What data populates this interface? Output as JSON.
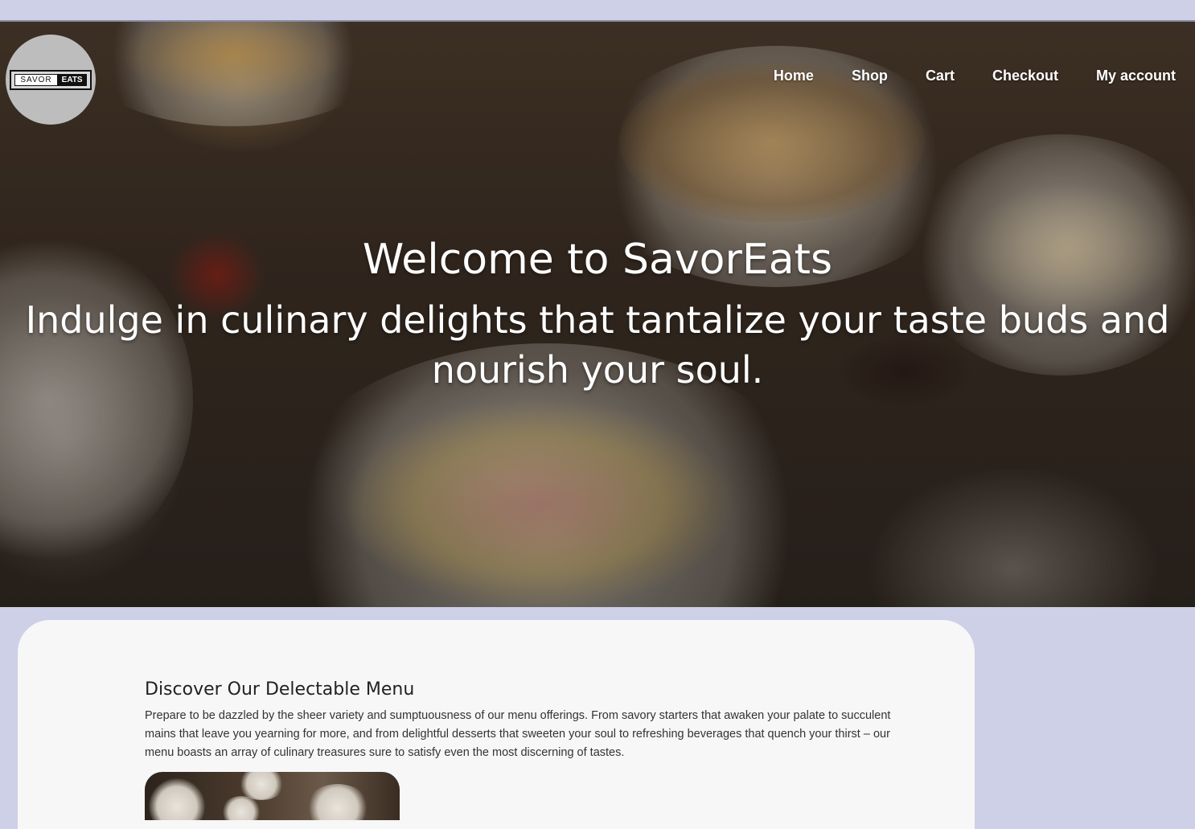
{
  "header": {
    "logo": {
      "left_text": "SAVOR",
      "right_text": "EATS"
    },
    "nav": [
      {
        "label": "Home"
      },
      {
        "label": "Shop"
      },
      {
        "label": "Cart"
      },
      {
        "label": "Checkout"
      },
      {
        "label": "My account"
      }
    ]
  },
  "hero": {
    "title": "Welcome to SavorEats",
    "subtitle": "Indulge in culinary delights that tantalize your taste buds and nourish your soul."
  },
  "menu_section": {
    "title": "Discover Our Delectable Menu",
    "description": "Prepare to be dazzled by the sheer variety and sumptuousness of our menu offerings. From savory starters that awaken your palate to succulent mains that leave you yearning for more, and from delightful desserts that sweeten your soul to refreshing beverages that quench your thirst – our menu boasts an array of culinary treasures sure to satisfy even the most discerning of tastes."
  },
  "colors": {
    "page_background": "#cdd0e6",
    "card_background": "#f7f7f7",
    "logo_circle": "#bdbdbd",
    "hero_text": "#ffffff"
  }
}
